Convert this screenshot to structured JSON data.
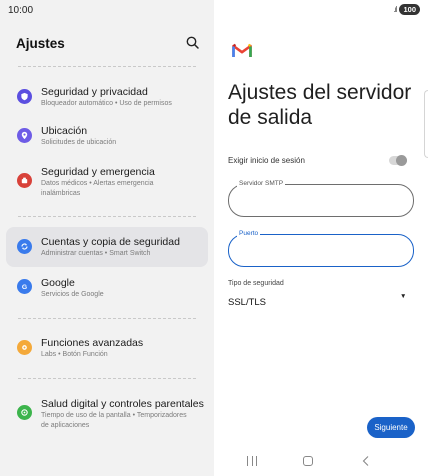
{
  "status_bar": {
    "time": "10:00",
    "battery": "100"
  },
  "settings": {
    "title": "Ajustes",
    "items": [
      {
        "label": "Seguridad y privacidad",
        "sub": "Bloqueador automático  •  Uso de permisos",
        "icon": "shield-icon",
        "color": "#5b4fe0"
      },
      {
        "label": "Ubicación",
        "sub": "Solicitudes de ubicación",
        "icon": "location-pin-icon",
        "color": "#6e5ce6"
      },
      {
        "label": "Seguridad y emergencia",
        "sub": "Datos médicos  •  Alertas emergencia inalámbricas",
        "icon": "emergency-icon",
        "color": "#d8423a"
      },
      {
        "label": "Cuentas y copia de seguridad",
        "sub": "Administrar cuentas  •  Smart Switch",
        "icon": "sync-icon",
        "color": "#3a7bec"
      },
      {
        "label": "Google",
        "sub": "Servicios de Google",
        "icon": "google-icon",
        "color": "#3a7bec"
      },
      {
        "label": "Funciones avanzadas",
        "sub": "Labs  •  Botón Función",
        "icon": "star-icon",
        "color": "#f4a93a"
      },
      {
        "label": "Salud digital y controles parentales",
        "sub": "Tiempo de uso de la pantalla  •  Temporizadores de aplicaciones",
        "icon": "digital-wellbeing-icon",
        "color": "#3cb44c"
      }
    ]
  },
  "gmail": {
    "title": "Ajustes del servidor de salida",
    "require_login_label": "Exigir inicio de sesión",
    "require_login_on": false,
    "smtp_label": "Servidor SMTP",
    "smtp_value": "",
    "port_label": "Puerto",
    "port_value": "",
    "security_label": "Tipo de seguridad",
    "security_value": "SSL/TLS",
    "next_label": "Siguiente",
    "accent_color": "#1a62c8"
  }
}
